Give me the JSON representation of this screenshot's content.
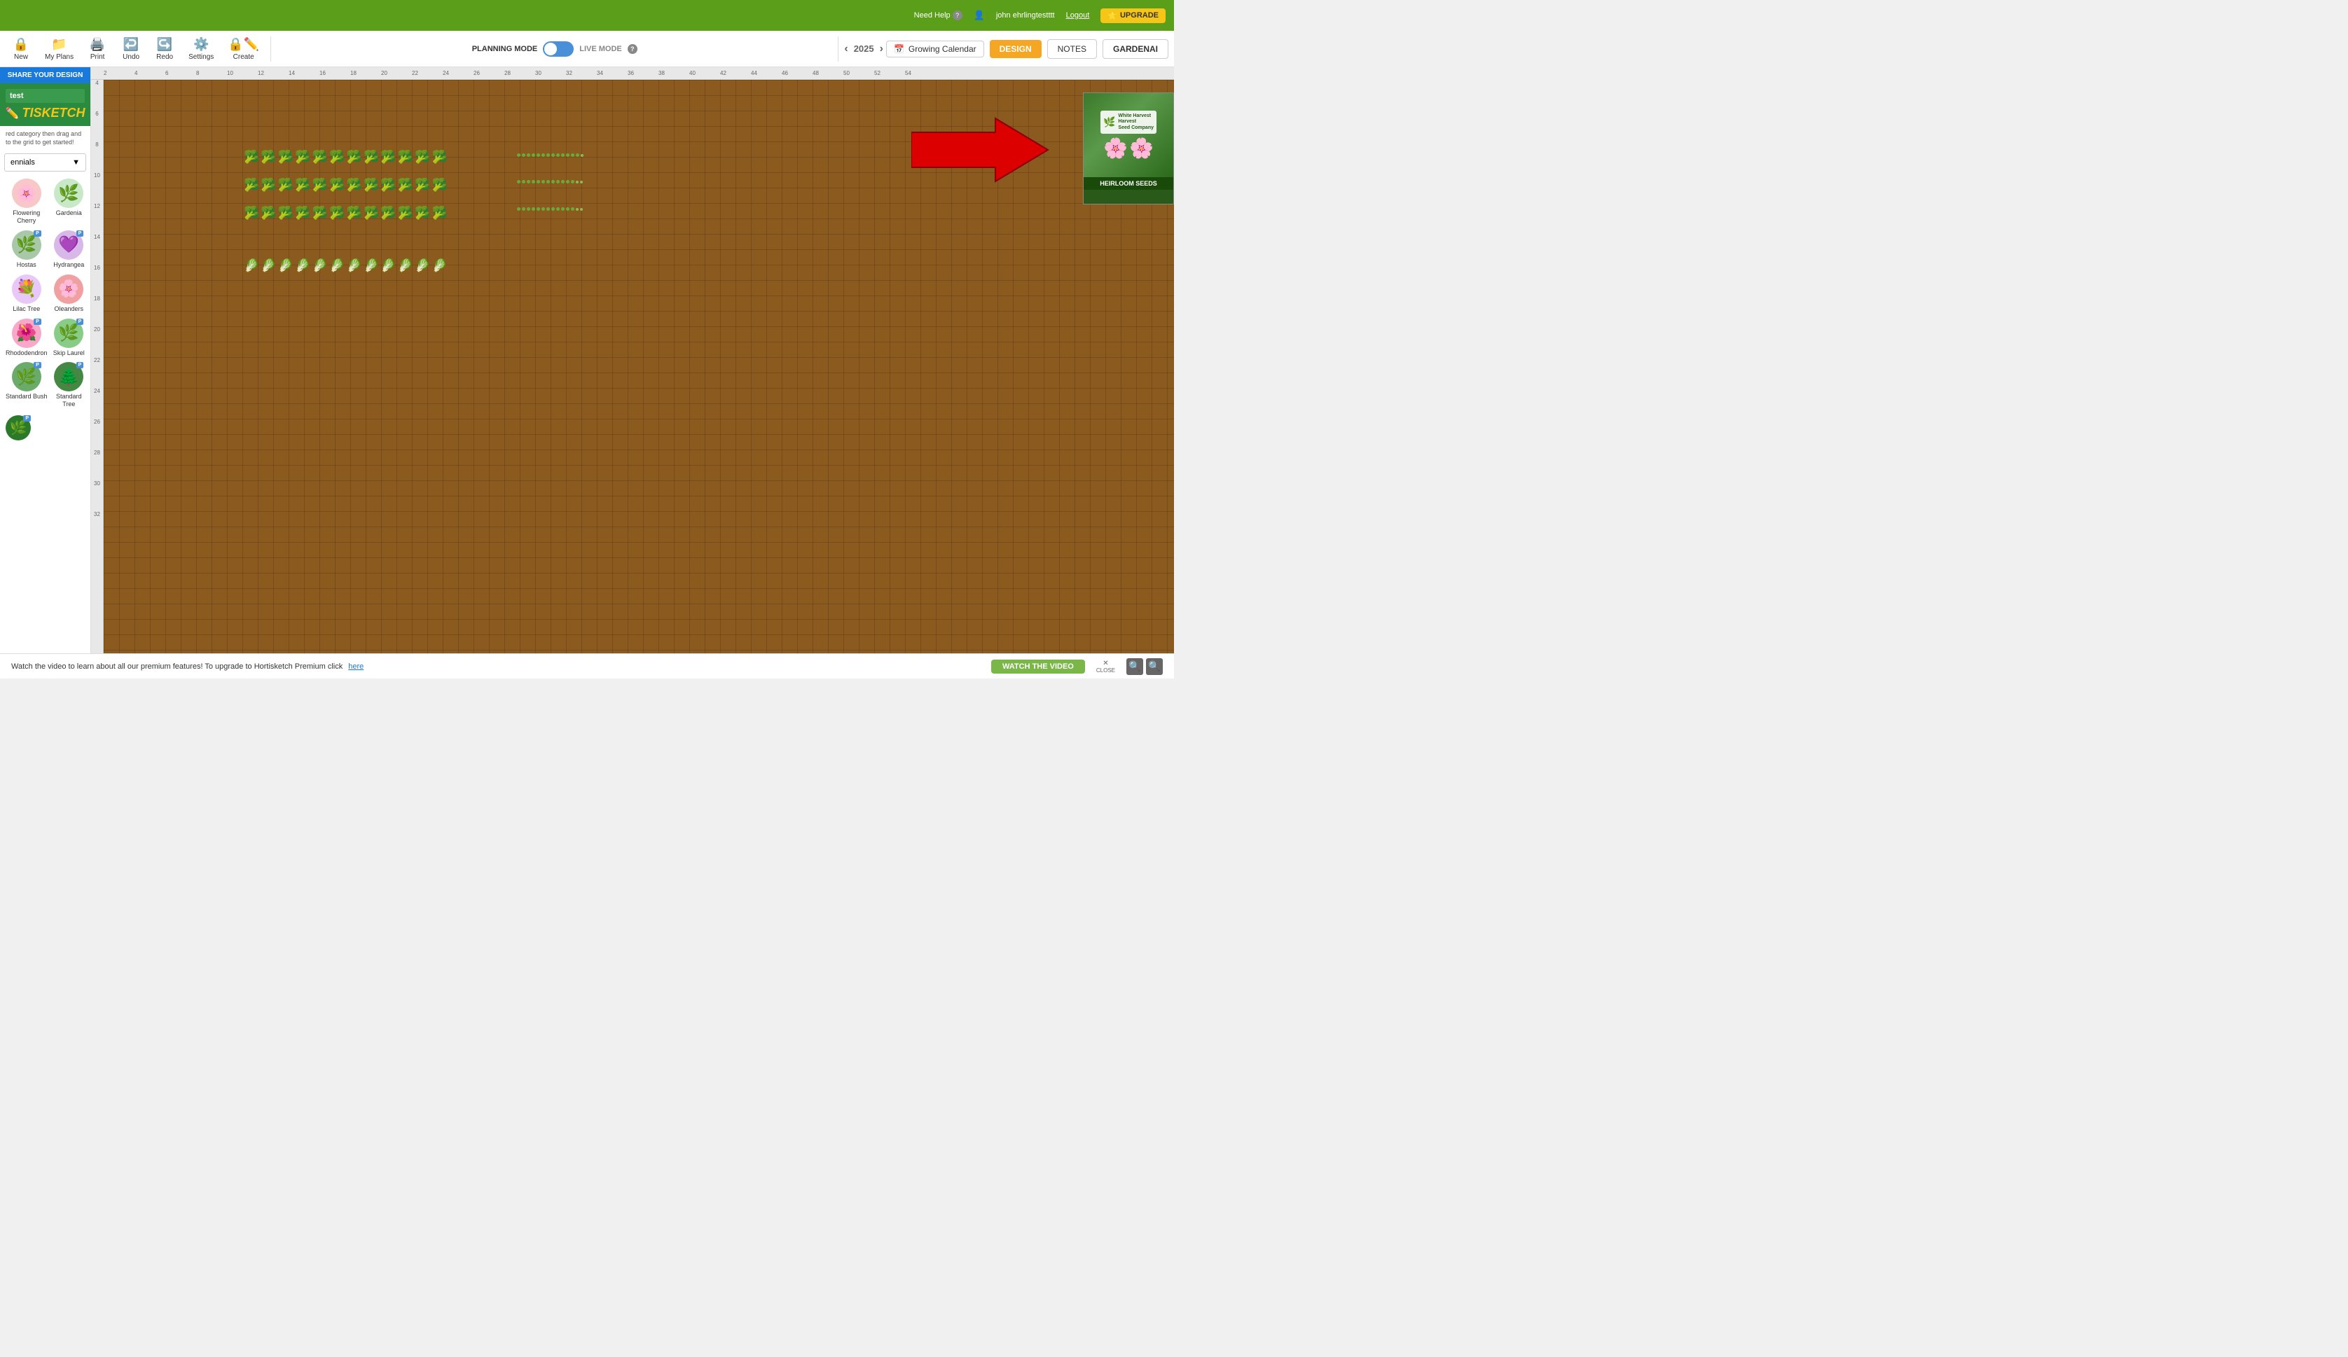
{
  "topbar": {
    "help_label": "Need Help",
    "help_icon": "?",
    "user_label": "john ehrlingtestttt",
    "logout_label": "Logout",
    "upgrade_label": "UPGRADE",
    "upgrade_icon": "⭐"
  },
  "toolbar": {
    "new_label": "New",
    "my_plans_label": "My Plans",
    "print_label": "Print",
    "undo_label": "Undo",
    "redo_label": "Redo",
    "settings_label": "Settings",
    "create_label": "Create",
    "planning_mode_label": "PLANNING MODE",
    "live_mode_label": "LIVE MODE",
    "year": "2025",
    "year_prev": "‹",
    "year_next": "›",
    "growing_calendar_label": "Growing Calendar",
    "design_label": "DESIGN",
    "notes_label": "NOTES",
    "gardenai_label": "GARDENAI"
  },
  "sidebar": {
    "share_label": "SHARE YOUR DESIGN",
    "project_name": "test",
    "logo_text": "TISKETCH",
    "instructions": "red category then drag and to the grid to get started!",
    "category_label": "ennials",
    "plants": [
      {
        "name": "Flowering Cherry",
        "emoji": "🌸",
        "color": "#f8c8c8",
        "premium": false
      },
      {
        "name": "Gardenia",
        "emoji": "🌿",
        "color": "#c8e8c8",
        "premium": false
      },
      {
        "name": "Hostas",
        "emoji": "🌿",
        "color": "#a8c8a8",
        "premium": false,
        "badge": "P"
      },
      {
        "name": "Hydrangea",
        "emoji": "💜",
        "color": "#d8b8e8",
        "premium": false,
        "badge": "P"
      },
      {
        "name": "Lilac Tree",
        "emoji": "💐",
        "color": "#e8c8f8",
        "premium": false
      },
      {
        "name": "Oleanders",
        "emoji": "🌸",
        "color": "#f0a0a0",
        "premium": false
      },
      {
        "name": "Rhododendron",
        "emoji": "🌺",
        "color": "#f8a8c8",
        "premium": false,
        "badge": "P"
      },
      {
        "name": "Skip Laurel",
        "emoji": "🌿",
        "color": "#88cc88",
        "premium": false,
        "badge": "P"
      },
      {
        "name": "Standard Bush",
        "emoji": "🌿",
        "color": "#6aaa6a",
        "premium": false,
        "badge": "P"
      },
      {
        "name": "Standard Tree",
        "emoji": "🌲",
        "color": "#448844",
        "premium": false,
        "badge": "P"
      }
    ]
  },
  "garden": {
    "broccoli_rows": 3,
    "broccoli_cols": 12,
    "cabbage_cols": 12,
    "dot_cols": 14,
    "dot_rows": 3
  },
  "notification": {
    "message": "Watch the video to learn about all our premium features! To upgrade to Hortisketch Premium click",
    "link_text": "here",
    "watch_label": "WATCH THE VIDEO",
    "close_label": "CLOSE"
  },
  "ad": {
    "company": "White Harvest",
    "company2": "Seed Company",
    "tagline": "HEIRLOOM SEEDS"
  },
  "ruler": {
    "top_marks": [
      "4",
      "6",
      "8",
      "10",
      "12",
      "14",
      "16",
      "18",
      "20",
      "22",
      "24",
      "26",
      "28",
      "30",
      "32",
      "34",
      "36",
      "38",
      "40",
      "42",
      "44",
      "46",
      "48",
      "50",
      "52",
      "54"
    ],
    "left_marks": [
      "4",
      "6",
      "8",
      "10",
      "12",
      "14",
      "16",
      "18",
      "20",
      "22",
      "24",
      "26",
      "28",
      "30",
      "32"
    ]
  }
}
